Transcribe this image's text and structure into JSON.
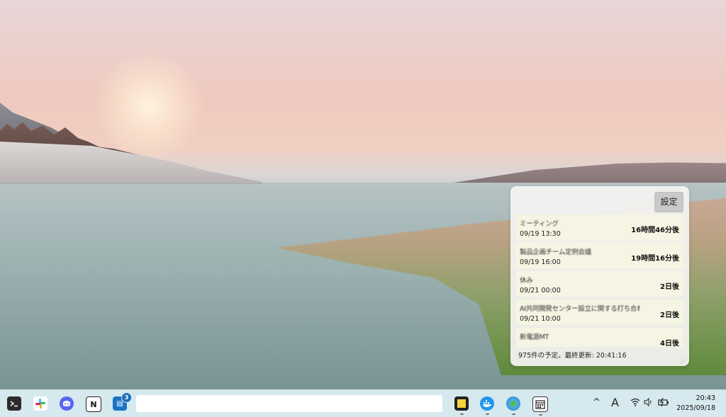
{
  "widget": {
    "settings_label": "設定",
    "events": [
      {
        "title": "ミーティング",
        "date": "09/19 13:30",
        "remaining": "16時間46分後"
      },
      {
        "title": "製品企画チーム定例会議",
        "date": "09/19 16:00",
        "remaining": "19時間16分後"
      },
      {
        "title": "休み",
        "date": "09/21 00:00",
        "remaining": "2日後"
      },
      {
        "title": "AI共同開発センター設立に関する打ち合わせ",
        "date": "09/21 10:00",
        "remaining": "2日後"
      },
      {
        "title": "新電源MT",
        "date": "",
        "remaining": "4日後"
      }
    ],
    "status": "975件の予定。最終更新: 20:41:16"
  },
  "taskbar": {
    "badge_count": "3",
    "search_placeholder": "",
    "ime_label": "A",
    "clock_time": "20:43",
    "clock_date": "2025/09/18"
  },
  "colors": {
    "taskbar_bg": "#d6e9ee",
    "widget_bg": "#f4f4f2",
    "event_bg": "#f6f4e3"
  }
}
